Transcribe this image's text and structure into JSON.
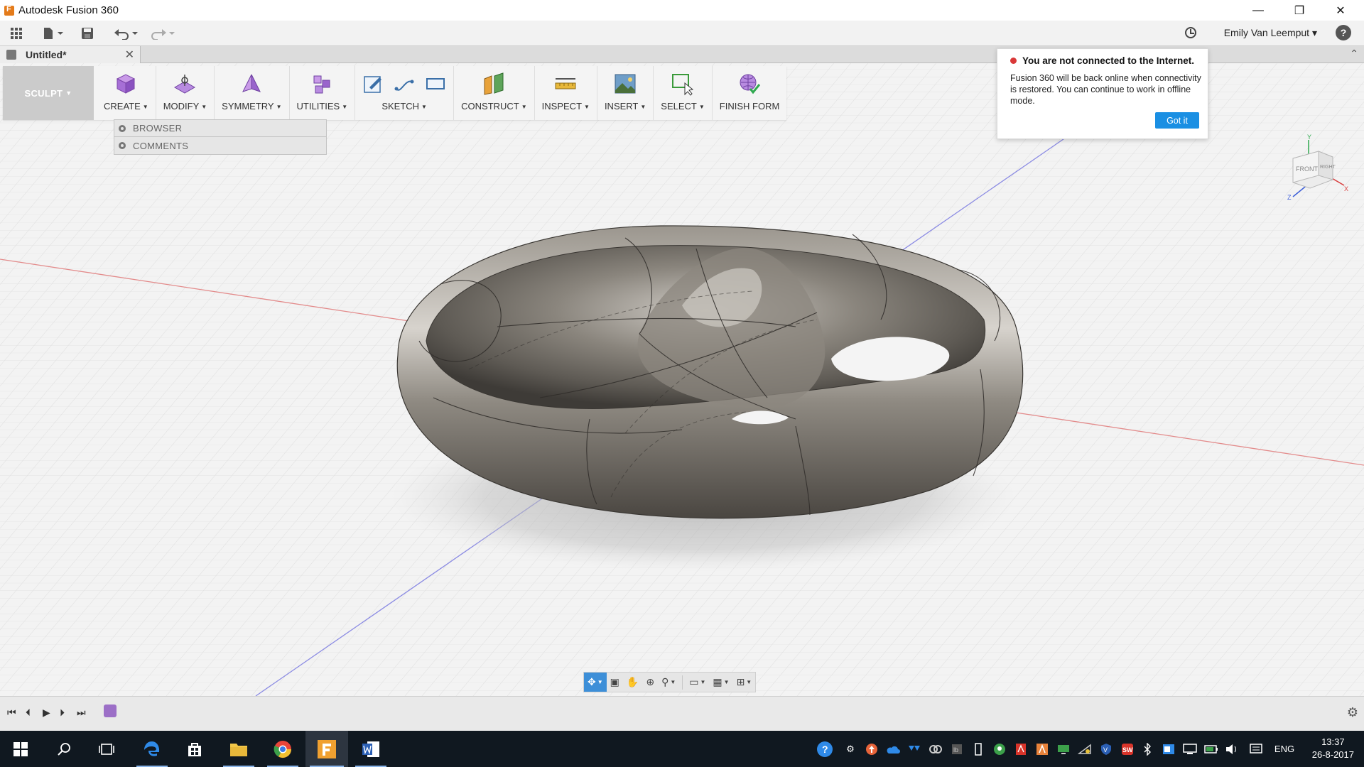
{
  "window": {
    "title": "Autodesk Fusion 360",
    "controls": [
      "minimize-icon",
      "restore-icon",
      "close-icon"
    ]
  },
  "quick_access": {
    "user_name": "Emily Van Leemput",
    "icons": [
      "data-panel-icon",
      "file-icon",
      "save-icon",
      "undo-icon",
      "redo-icon",
      "job-status-icon",
      "help-icon"
    ]
  },
  "document_tab": {
    "label": "Untitled*"
  },
  "toolbar": {
    "workspace": "SCULPT",
    "groups": [
      {
        "label": "CREATE",
        "icons": [
          "box-icon"
        ]
      },
      {
        "label": "MODIFY",
        "icons": [
          "edit-form-icon"
        ]
      },
      {
        "label": "SYMMETRY",
        "icons": [
          "symmetry-icon"
        ]
      },
      {
        "label": "UTILITIES",
        "icons": [
          "utilities-icon"
        ]
      },
      {
        "label": "SKETCH",
        "icons": [
          "create-sketch-icon",
          "spline-icon",
          "rectangle-icon"
        ]
      },
      {
        "label": "CONSTRUCT",
        "icons": [
          "construct-plane-icon"
        ]
      },
      {
        "label": "INSPECT",
        "icons": [
          "measure-icon"
        ]
      },
      {
        "label": "INSERT",
        "icons": [
          "canvas-image-icon"
        ]
      },
      {
        "label": "SELECT",
        "icons": [
          "select-icon"
        ]
      },
      {
        "label": "FINISH FORM",
        "icons": [
          "finish-form-icon"
        ]
      }
    ]
  },
  "browser_panel": {
    "items": [
      "BROWSER",
      "COMMENTS"
    ]
  },
  "notification": {
    "title": "You are not connected to the Internet.",
    "body": "Fusion 360 will be back online when connectivity is restored. You can continue to work in offline mode.",
    "button": "Got it"
  },
  "viewcube": {
    "front_label": "FRONT",
    "right_label": "RIGHT",
    "axis_x": "X",
    "axis_y": "Y",
    "axis_z": "Z"
  },
  "timeline": {
    "controls": [
      "go-to-start-icon",
      "step-back-icon",
      "play-icon",
      "step-forward-icon",
      "go-to-end-icon"
    ]
  },
  "taskbar": {
    "apps": [
      "windows-start-icon",
      "search-icon",
      "task-view-icon",
      "edge-icon",
      "store-icon",
      "file-explorer-icon",
      "chrome-icon",
      "fusion360-icon",
      "word-icon"
    ],
    "language": "ENG",
    "time": "13:37",
    "date": "26-8-2017"
  },
  "colors": {
    "accent_blue": "#1a8fe3",
    "alert_red": "#d93838",
    "taskbar_bg": "#101820",
    "toolbar_bg": "#f4f4f4",
    "viewport_bg": "#f0f0f0"
  }
}
